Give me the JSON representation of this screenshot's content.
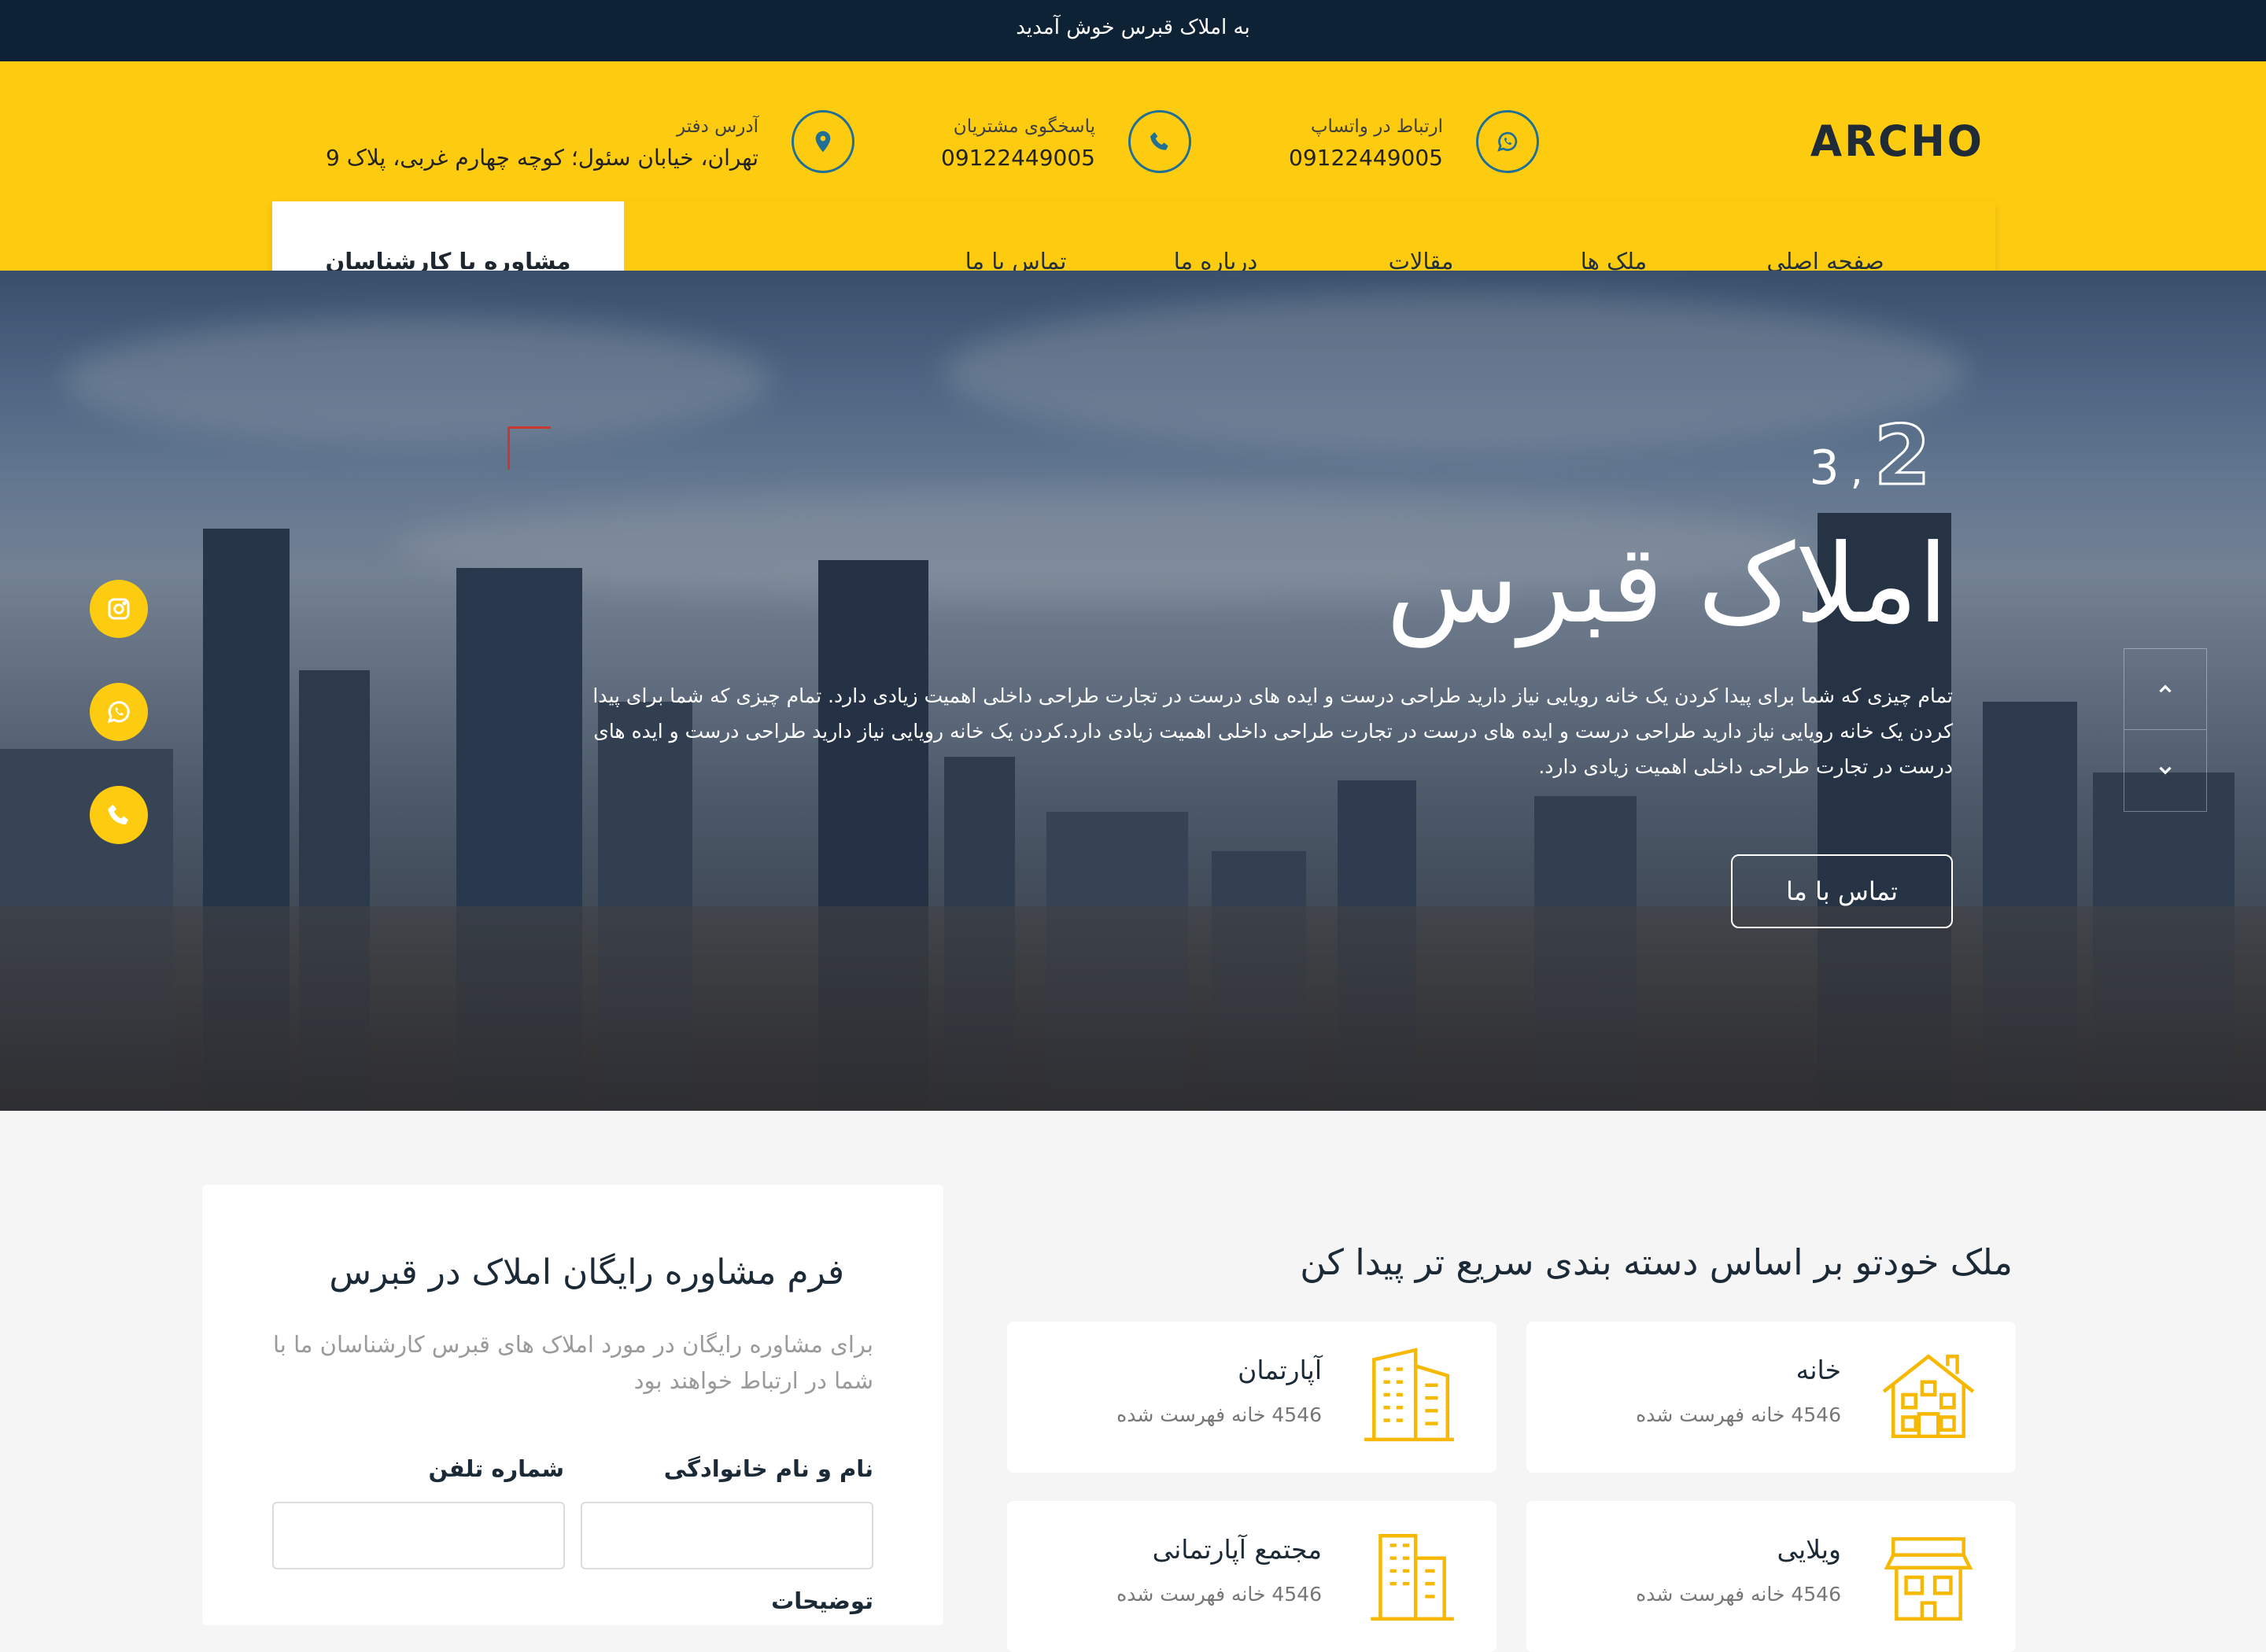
{
  "topbar": {
    "welcome": "به املاک قبرس خوش آمدید"
  },
  "header": {
    "logo": "ARCHO",
    "contacts": [
      {
        "label": "ارتباط در واتساپ",
        "value": "09122449005",
        "icon": "whatsapp-icon"
      },
      {
        "label": "پاسخگوی مشتریان",
        "value": "09122449005",
        "icon": "phone-icon"
      },
      {
        "label": "آدرس دفتر",
        "value": "تهران، خیابان سئول؛ کوچه چهارم غربی، پلاک 9",
        "icon": "location-icon"
      }
    ]
  },
  "nav": {
    "items": [
      "صفحه اصلی",
      "ملک ها",
      "مقالات",
      "درباره ما",
      "تماس با ما"
    ],
    "active": "صفحه اصلی",
    "consult_button": "مشاوره با کارشناسان"
  },
  "hero": {
    "slide_current": "2",
    "slide_separator": ",",
    "slide_total": "3",
    "title": "املاک قبرس",
    "description": "تمام چیزی که شما برای پیدا کردن یک خانه رویایی نیاز دارید طراحی درست و ایده های درست در تجارت طراحی داخلی اهمیت زیادی دارد. تمام چیزی که شما برای پیدا کردن یک خانه رویایی نیاز دارید طراحی درست و ایده های درست در تجارت طراحی داخلی اهمیت زیادی دارد.کردن یک خانه رویایی نیاز دارید طراحی درست و ایده های درست در تجارت طراحی داخلی اهمیت زیادی دارد.",
    "button": "تماس با ما",
    "accent_color": "#c9382f"
  },
  "social": [
    "instagram-icon",
    "whatsapp-icon",
    "phone-icon"
  ],
  "form": {
    "title": "فرم مشاوره رایگان املاک در قبرس",
    "description": "برای مشاوره رایگان در مورد املاک های قبرس کارشناسان ما با شما در ارتباط خواهند بود",
    "name_label": "نام و نام خانوادگی",
    "phone_label": "شماره تلفن",
    "notes_label": "توضیحات"
  },
  "categories": {
    "title": "ملک خودتو بر اساس دسته بندی سریع تر پیدا کن",
    "items": [
      {
        "name": "خانه",
        "count": "4546 خانه فهرست شده",
        "icon": "house-icon"
      },
      {
        "name": "آپارتمان",
        "count": "4546 خانه فهرست شده",
        "icon": "apartment-icon"
      },
      {
        "name": "ویلایی",
        "count": "4546 خانه فهرست شده",
        "icon": "villa-icon"
      },
      {
        "name": "مجتمع آپارتمانی",
        "count": "4546 خانه فهرست شده",
        "icon": "complex-icon"
      }
    ]
  },
  "colors": {
    "brand_yellow": "#fdcb10",
    "dark_navy": "#0e2235",
    "icon_blue": "#1f6f96"
  }
}
